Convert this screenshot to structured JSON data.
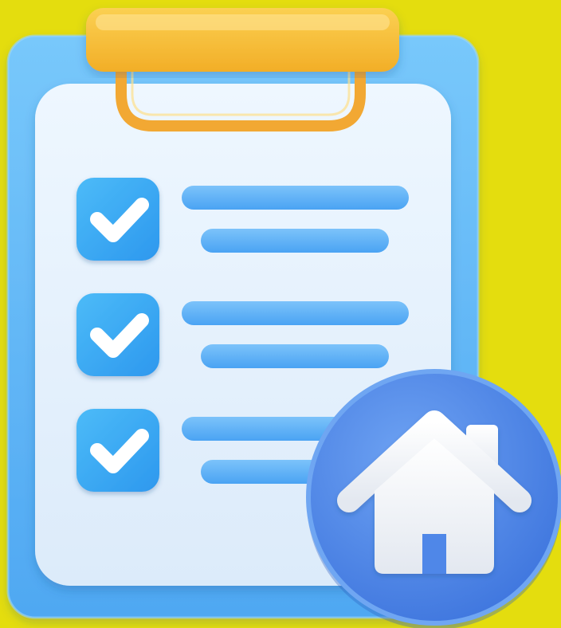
{
  "scene": {
    "background_color": "#E4DD0E",
    "board_color": "#5FB8F8",
    "paper_color": "#E6F3FF",
    "clip_color": "#F8C436",
    "checkbox_color": "#37A9F3",
    "checkmark_color": "#FFFFFF",
    "line_color": "#5FB1F7",
    "home_badge_color": "#4F87E8",
    "house_color": "#EFF2F7"
  },
  "icons": {
    "clipboard": "clipboard-icon",
    "checkbox": "checkbox-checked-icon",
    "home": "home-icon"
  },
  "checklist": {
    "items": [
      {
        "checked": true
      },
      {
        "checked": true
      },
      {
        "checked": true
      }
    ]
  }
}
